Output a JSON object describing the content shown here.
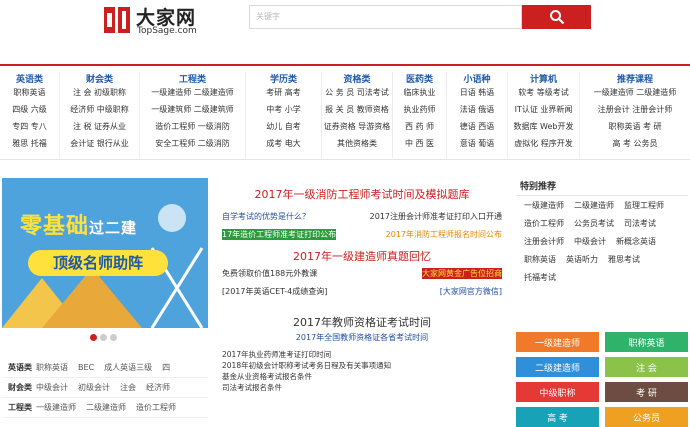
{
  "header": {
    "logo_cn": "大家网",
    "logo_en": "TopSage.com",
    "search_placeholder": "关键字"
  },
  "nav": [
    {
      "title": "英语类",
      "rows": [
        "职称英语",
        "四级 六级",
        "专四 专八",
        "雅思 托福"
      ]
    },
    {
      "title": "财会类",
      "rows": [
        "注 会 初级职称",
        "经济师 中级职称",
        "注 税 证券从业",
        "会计证 银行从业"
      ]
    },
    {
      "title": "工程类",
      "rows": [
        "一级建造师 二级建造师",
        "一级建筑师 二级建筑师",
        "造价工程师 一级消防",
        "安全工程师 二级消防"
      ]
    },
    {
      "title": "学历类",
      "rows": [
        "考研 高考",
        "中考 小学",
        "幼儿 自考",
        "成考 电大"
      ]
    },
    {
      "title": "资格类",
      "rows": [
        "公 务 员 司法考试",
        "报 关 员 教师资格",
        "证券资格 导游资格",
        "其他资格类"
      ]
    },
    {
      "title": "医药类",
      "rows": [
        "临床执业",
        "执业药师",
        "西 药 师",
        "中 西 医"
      ]
    },
    {
      "title": "小语种",
      "rows": [
        "日语 韩语",
        "法语 俄语",
        "德语 西语",
        "意语 葡语"
      ]
    },
    {
      "title": "计算机",
      "rows": [
        "软考 等级考试",
        "IT认证 业界新闻",
        "数据库 Web开发",
        "虚拟化 程序开发"
      ]
    },
    {
      "title": "推荐课程",
      "rows": [
        "一级建造师 二级建造师",
        "注册会计 注册会计师",
        "职称英语 考 研",
        "高 考 公务员"
      ]
    }
  ],
  "banner": {
    "headline_a": "零基础",
    "headline_b": "过二建",
    "tagline": "顶级名师助阵"
  },
  "left_links": [
    {
      "cat": "英语类",
      "items": [
        "职称英语",
        "BEC",
        "成人英语三级",
        "四"
      ]
    },
    {
      "cat": "财会类",
      "items": [
        "中级会计",
        "初级会计",
        "注会",
        "经济师"
      ]
    },
    {
      "cat": "工程类",
      "items": [
        "一级建造师",
        "二级建造师",
        "造价工程师"
      ]
    }
  ],
  "news": {
    "head1": "2017年一级消防工程师考试时间及模拟题库",
    "line1_left": "自学考试的优势是什么？",
    "line1_right": "2017注册会计师准考证打印入口开通",
    "line2_left": "17年造价工程师准考证打印公布",
    "line2_right": "2017年消防工程师报名时间公布",
    "head2": "2017年一级建造师真题回忆",
    "line3_left": "免费领取价值188元外教课",
    "line3_right": "大家网黄金广告位招商",
    "line4_left": "[2017年英语CET-4成绩查询]",
    "line4_right": "[大家网官方微信]",
    "head3": "2017年教师资格证考试时间",
    "sub3": "2017年全国教师资格证各省考试时间",
    "list": [
      "2017年执业药师准考证打印时间",
      "2018年初级会计职称考试考务日程及有关事项通知",
      "基金从业资格考试报名条件",
      "司法考试报名条件"
    ]
  },
  "right": {
    "title": "特别推荐",
    "items": [
      "一级建造师",
      "二级建造师",
      "监理工程师",
      "造价工程师",
      "公务员考试",
      "司法考试",
      "注册会计师",
      "中级会计",
      "新概念英语",
      "职称英语",
      "英语听力",
      "雅思考试",
      "托福考试"
    ],
    "buttons": [
      {
        "label": "一级建造师",
        "color": "#f07a2a"
      },
      {
        "label": "职称英语",
        "color": "#2fb36b"
      },
      {
        "label": "二级建造师",
        "color": "#2f8fd8"
      },
      {
        "label": "注 会",
        "color": "#8bc34a"
      },
      {
        "label": "中级职称",
        "color": "#e53935"
      },
      {
        "label": "考 研",
        "color": "#6d4c41"
      },
      {
        "label": "高 考",
        "color": "#17a2b8"
      },
      {
        "label": "公务员",
        "color": "#f0a020"
      }
    ]
  },
  "colors": {
    "brand": "#cc1f1f",
    "link": "#1f5aa8"
  }
}
